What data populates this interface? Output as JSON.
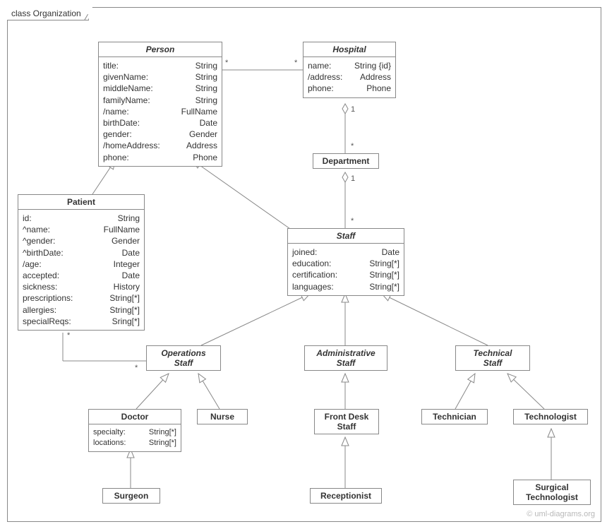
{
  "frame_label": "class Organization",
  "copyright": "© uml-diagrams.org",
  "classes": {
    "person": {
      "name": "Person",
      "attrs": [
        [
          "title:",
          "String"
        ],
        [
          "givenName:",
          "String"
        ],
        [
          "middleName:",
          "String"
        ],
        [
          "familyName:",
          "String"
        ],
        [
          "/name:",
          "FullName"
        ],
        [
          "birthDate:",
          "Date"
        ],
        [
          "gender:",
          "Gender"
        ],
        [
          "/homeAddress:",
          "Address"
        ],
        [
          "phone:",
          "Phone"
        ]
      ]
    },
    "hospital": {
      "name": "Hospital",
      "attrs": [
        [
          "name:",
          "String {id}"
        ],
        [
          "/address:",
          "Address"
        ],
        [
          "phone:",
          "Phone"
        ]
      ]
    },
    "department": {
      "name": "Department"
    },
    "patient": {
      "name": "Patient",
      "attrs": [
        [
          "id:",
          "String"
        ],
        [
          "^name:",
          "FullName"
        ],
        [
          "^gender:",
          "Gender"
        ],
        [
          "^birthDate:",
          "Date"
        ],
        [
          "/age:",
          "Integer"
        ],
        [
          "accepted:",
          "Date"
        ],
        [
          "sickness:",
          "History"
        ],
        [
          "prescriptions:",
          "String[*]"
        ],
        [
          "allergies:",
          "String[*]"
        ],
        [
          "specialReqs:",
          "Sring[*]"
        ]
      ]
    },
    "staff": {
      "name": "Staff",
      "attrs": [
        [
          "joined:",
          "Date"
        ],
        [
          "education:",
          "String[*]"
        ],
        [
          "certification:",
          "String[*]"
        ],
        [
          "languages:",
          "String[*]"
        ]
      ]
    },
    "operations_staff": {
      "name": "Operations\nStaff"
    },
    "administrative_staff": {
      "name": "Administrative\nStaff"
    },
    "technical_staff": {
      "name": "Technical\nStaff"
    },
    "doctor": {
      "name": "Doctor",
      "attrs": [
        [
          "specialty:",
          "String[*]"
        ],
        [
          "locations:",
          "String[*]"
        ]
      ]
    },
    "nurse": {
      "name": "Nurse"
    },
    "front_desk_staff": {
      "name": "Front Desk\nStaff"
    },
    "technician": {
      "name": "Technician"
    },
    "technologist": {
      "name": "Technologist"
    },
    "surgeon": {
      "name": "Surgeon"
    },
    "receptionist": {
      "name": "Receptionist"
    },
    "surgical_technologist": {
      "name": "Surgical\nTechnologist"
    }
  },
  "multiplicities": {
    "person_hospital_left": "*",
    "person_hospital_right": "*",
    "hospital_department_top": "1",
    "hospital_department_bottom": "*",
    "department_staff_top": "1",
    "department_staff_bottom": "*",
    "patient_opstaff_top": "*",
    "patient_opstaff_bottom": "*"
  }
}
